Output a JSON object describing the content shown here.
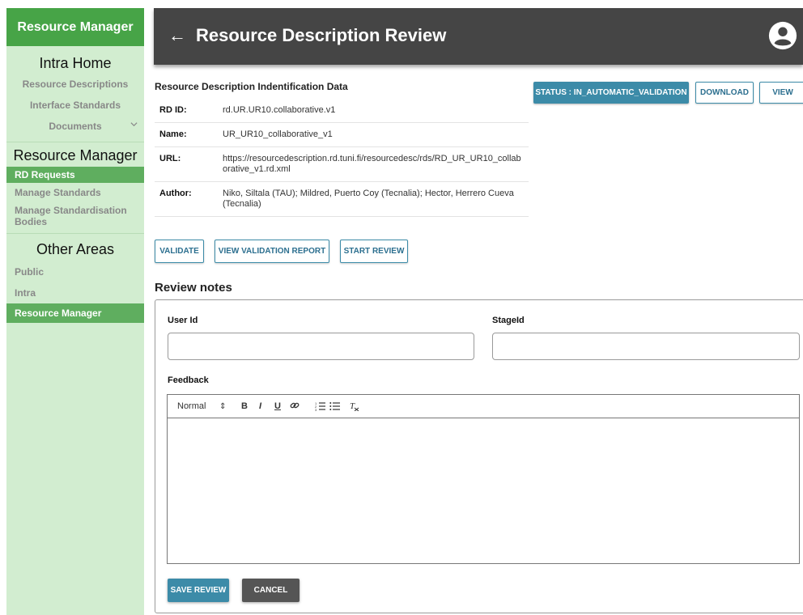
{
  "sidebar": {
    "brand": "Resource Manager",
    "sections": [
      {
        "title": "Intra Home",
        "items": [
          {
            "label": "Resource Descriptions"
          },
          {
            "label": "Interface Standards"
          },
          {
            "label": "Documents",
            "icon": "chevron-down-icon"
          }
        ]
      },
      {
        "title": "Resource Manager",
        "items": [
          {
            "label": "RD Requests",
            "active": true
          },
          {
            "label": "Manage Standards"
          },
          {
            "label": "Manage Standardisation Bodies"
          }
        ]
      },
      {
        "title": "Other Areas",
        "items": [
          {
            "label": "Public"
          },
          {
            "label": "Intra"
          },
          {
            "label": "Resource Manager",
            "active": true
          }
        ]
      }
    ]
  },
  "header": {
    "back_icon": "arrow-left-icon",
    "back_glyph": "←",
    "title": "Resource Description Review",
    "avatar_icon": "account-circle-icon"
  },
  "identification": {
    "title": "Resource Description Indentification Data",
    "rows": [
      {
        "label": "RD ID:",
        "value": "rd.UR.UR10.collaborative.v1"
      },
      {
        "label": "Name:",
        "value": "UR_UR10_collaborative_v1"
      },
      {
        "label": "URL:",
        "value": "https://resourcedescription.rd.tuni.fi/resourcedesc/rds/RD_UR_UR10_collaborative_v1.rd.xml"
      },
      {
        "label": "Author:",
        "value": "Niko, Siltala (TAU); Mildred, Puerto Coy (Tecnalia); Hector, Herrero Cueva (Tecnalia)"
      }
    ]
  },
  "top_actions": {
    "status": "STATUS : IN_AUTOMATIC_VALIDATION",
    "download": "DOWNLOAD",
    "view": "VIEW"
  },
  "actions": {
    "validate": "VALIDATE",
    "view_report": "VIEW VALIDATION REPORT",
    "start_review": "START REVIEW"
  },
  "review": {
    "title": "Review notes",
    "user_id_label": "User Id",
    "user_id_value": "",
    "stage_id_label": "StageId",
    "stage_id_value": "",
    "feedback_label": "Feedback",
    "toolbar": {
      "format": "Normal",
      "format_glyph": "⇕",
      "bold": "B",
      "italic": "I",
      "underline": "U",
      "link_glyph": "🔗",
      "ordered_list_glyph": "⋮≡",
      "bullet_list_glyph": "≡",
      "clean_glyph": "Tx"
    },
    "save": "SAVE REVIEW",
    "cancel": "CANCEL"
  },
  "colors": {
    "sidebar_bg": "#d2edd0",
    "brand_green": "#47a447",
    "active_green": "#5fae5f",
    "header_bg": "#454545",
    "accent_blue": "#3c8ba8",
    "cancel_gray": "#555555"
  }
}
